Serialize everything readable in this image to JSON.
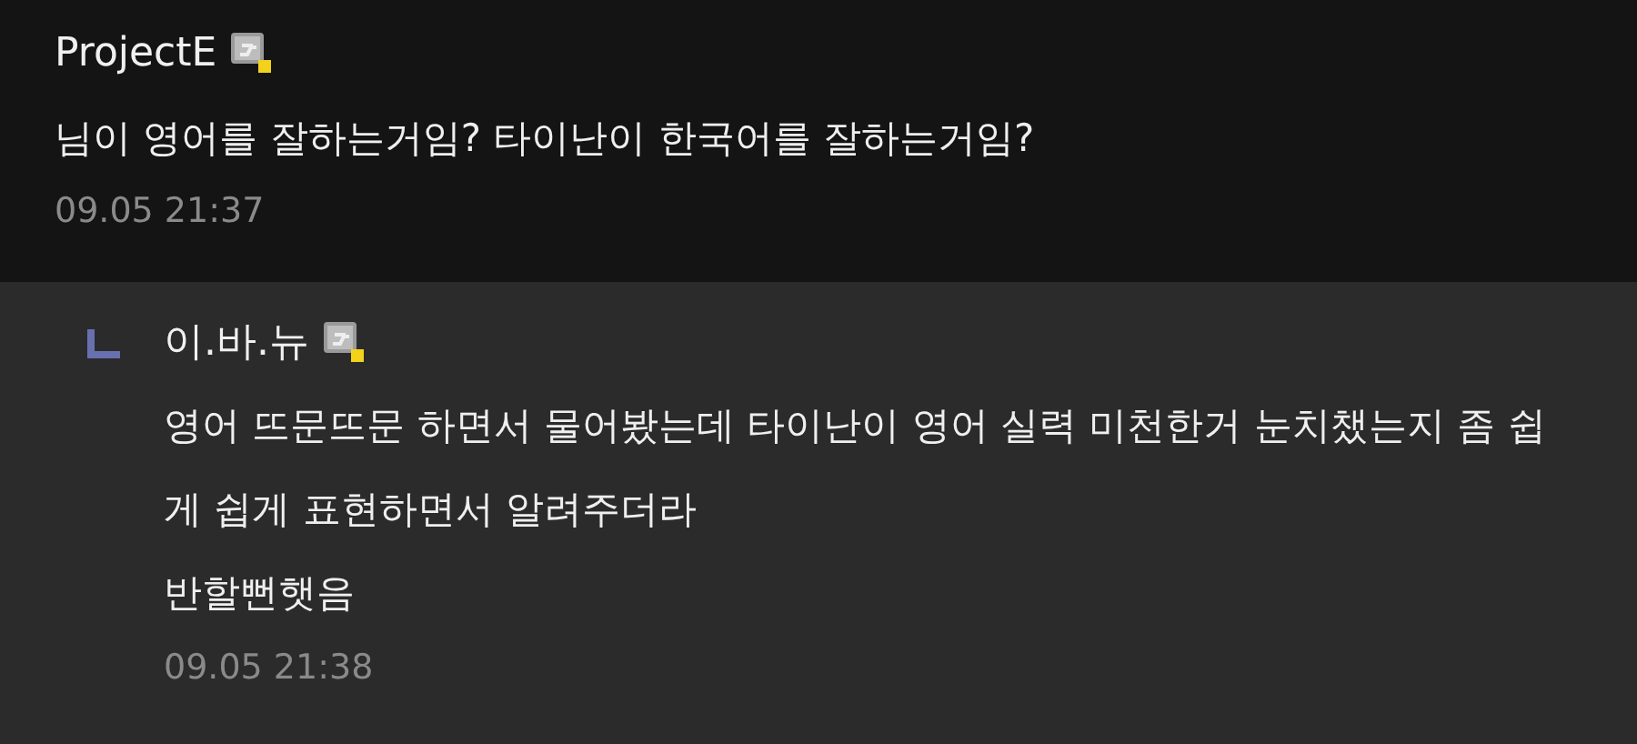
{
  "comment": {
    "author": "ProjectE",
    "text": "님이 영어를 잘하는거임? 타이난이 한국어를 잘하는거임?",
    "time": "09.05 21:37"
  },
  "reply": {
    "author": "이.바.뉴",
    "lines": [
      "영어 뜨문뜨문 하면서 물어봤는데 타이난이 영어 실력 미천한거 눈치챘는지 좀 쉽게 쉽게 표현하면서 알려주더라",
      "반할뻔햇음"
    ],
    "time": "09.05 21:38"
  }
}
